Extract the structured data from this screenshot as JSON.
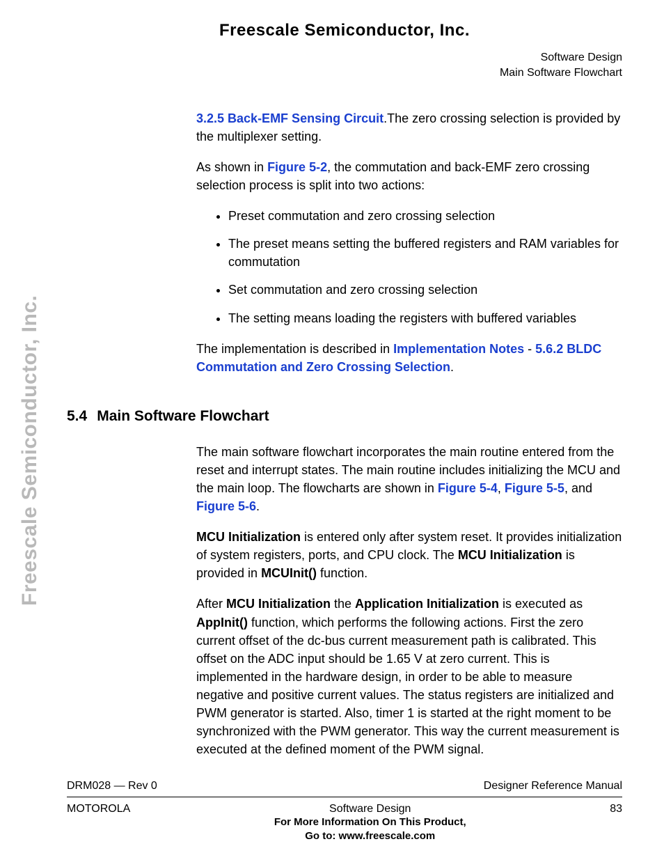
{
  "header": {
    "org": "Freescale Semiconductor, Inc.",
    "rightLine1": "Software Design",
    "rightLine2": "Main Software Flowchart"
  },
  "sideBrand": "Freescale Semiconductor, Inc.",
  "block1": {
    "linkA": "3.2.5 Back-EMF Sensing Circuit",
    "afterLinkA": ".The zero crossing selection is provided by the multiplexer setting.",
    "p2_before": "As shown in ",
    "p2_link": "Figure 5-2",
    "p2_after": ", the commutation and back-EMF zero crossing selection process is split into two actions:",
    "bullets": [
      "Preset commutation and zero crossing selection",
      "The preset means setting the buffered registers and RAM variables for commutation",
      "Set commutation and zero crossing selection",
      "The setting means loading the registers with buffered variables"
    ],
    "p3_before": "The implementation is described in ",
    "p3_link1": "Implementation Notes",
    "p3_dash": " - ",
    "p3_link2": "5.6.2 BLDC Commutation and Zero Crossing Selection",
    "p3_after": "."
  },
  "section": {
    "num": "5.4",
    "title": "Main Software Flowchart",
    "p1_before": "The main software flowchart incorporates the main routine entered from the reset and interrupt states. The main routine includes initializing the MCU and the main loop. The flowcharts are shown in ",
    "p1_l1": "Figure 5-4",
    "p1_m1": ", ",
    "p1_l2": "Figure 5-5",
    "p1_m2": ", and ",
    "p1_l3": "Figure 5-6",
    "p1_after": ".",
    "p2_b1": "MCU Initialization",
    "p2_t1": " is entered only after system reset. It provides initialization of system registers, ports, and CPU clock. The ",
    "p2_b2": "MCU Initialization",
    "p2_t2": " is provided in ",
    "p2_b3": "MCUInit()",
    "p2_t3": " function.",
    "p3_t0": "After ",
    "p3_b1": "MCU Initialization",
    "p3_t1": " the ",
    "p3_b2": "Application Initialization",
    "p3_t2": " is executed as ",
    "p3_b3": "AppInit()",
    "p3_t3": " function, which performs the following actions. First the zero current offset of the dc-bus current measurement path is calibrated. This offset on the ADC input should be 1.65 V at zero current. This is implemented in the hardware design, in order to be able to measure negative and positive current values. The status registers are initialized and PWM generator is started. Also, timer 1 is started at the right moment to be synchronized with the PWM generator. This way the current measurement is executed at the defined moment of the PWM signal."
  },
  "footer": {
    "leftTop": "DRM028 — Rev 0",
    "rightTop": "Designer Reference Manual",
    "leftBottom": "MOTOROLA",
    "centerLine1": "Software Design",
    "centerBold1": "For More Information On This Product,",
    "centerBold2": "Go to: www.freescale.com",
    "rightBottom": "83"
  }
}
